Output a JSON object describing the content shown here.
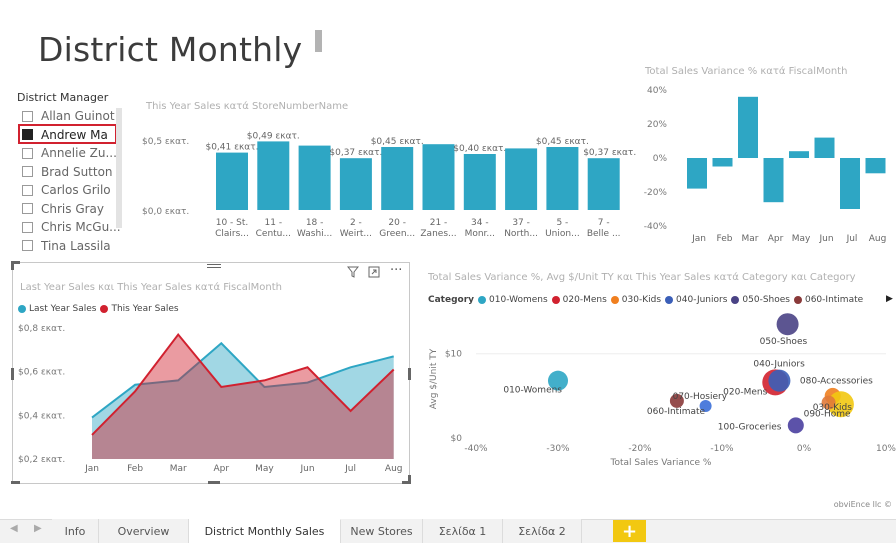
{
  "page_title": "District Monthly",
  "slicer": {
    "title": "District Manager",
    "items": [
      {
        "label": "Allan Guinot",
        "selected": false
      },
      {
        "label": "Andrew Ma",
        "selected": true
      },
      {
        "label": "Annelie Zu...",
        "selected": false
      },
      {
        "label": "Brad Sutton",
        "selected": false
      },
      {
        "label": "Carlos Grilo",
        "selected": false
      },
      {
        "label": "Chris Gray",
        "selected": false
      },
      {
        "label": "Chris McGu...",
        "selected": false
      },
      {
        "label": "Tina Lassila",
        "selected": false
      }
    ]
  },
  "bar_chart": {
    "title": "This Year Sales κατά StoreNumberName",
    "y_ticks": [
      "$0,5 εκατ.",
      "$0,0 εκατ."
    ],
    "color": "#2ea6c4"
  },
  "variance_chart": {
    "title": "Total Sales Variance % κατά FiscalMonth",
    "y_ticks": [
      "40%",
      "20%",
      "0%",
      "-20%",
      "-40%"
    ],
    "color": "#2ea6c4"
  },
  "line_chart": {
    "title": "Last Year Sales και This Year Sales κατά FiscalMonth",
    "y_ticks": [
      "$0,8 εκατ.",
      "$0,6 εκατ.",
      "$0,4 εκατ.",
      "$0,2 εκατ."
    ],
    "colors": {
      "last_year": "#2ea6c4",
      "this_year": "#d1212f"
    },
    "header_icons": [
      "filter-icon",
      "focus-mode-icon",
      "more-options-icon"
    ],
    "more_glyph": "···"
  },
  "scatter_chart": {
    "title": "Total Sales Variance %, Avg $/Unit TY και This Year Sales κατά Category και Category",
    "legend_label": "Category",
    "y_axis_label": "Avg $/Unit TY",
    "x_axis_label": "Total Sales Variance %",
    "y_ticks": [
      "$10",
      "$0"
    ],
    "x_ticks": [
      "-40%",
      "-30%",
      "-20%",
      "-10%",
      "0%",
      "10%"
    ]
  },
  "chart_data": [
    {
      "type": "bar",
      "title": "This Year Sales κατά StoreNumberName",
      "categories": [
        "10 - St. Clairs...",
        "11 - Centu...",
        "18 - Washi...",
        "2 - Weirt...",
        "20 - Green...",
        "21 - Zanes...",
        "34 - Monr...",
        "37 - North...",
        "5 - Union...",
        "7 - Belle ..."
      ],
      "category_lines": [
        [
          "10 - St.",
          "Clairs..."
        ],
        [
          "11 -",
          "Centu..."
        ],
        [
          "18 -",
          "Washi..."
        ],
        [
          "2 -",
          "Weirt..."
        ],
        [
          "20 -",
          "Green..."
        ],
        [
          "21 -",
          "Zanes..."
        ],
        [
          "34 -",
          "Monr..."
        ],
        [
          "37 -",
          "North..."
        ],
        [
          "5 -",
          "Union..."
        ],
        [
          "7 -",
          "Belle ..."
        ]
      ],
      "values": [
        0.41,
        0.49,
        0.46,
        0.37,
        0.45,
        0.47,
        0.4,
        0.44,
        0.45,
        0.37
      ],
      "data_labels": [
        "$0,41 εκατ.",
        "$0,49 εκατ.",
        "",
        "$0,37 εκατ.",
        "$0,45 εκατ.",
        "",
        "$0,40 εκατ.",
        "",
        "$0,45 εκατ.",
        "$0,37 εκατ."
      ],
      "ylim": [
        0,
        0.5
      ],
      "unit": "εκατ."
    },
    {
      "type": "bar",
      "title": "Total Sales Variance % κατά FiscalMonth",
      "categories": [
        "Jan",
        "Feb",
        "Mar",
        "Apr",
        "May",
        "Jun",
        "Jul",
        "Aug"
      ],
      "values": [
        -18,
        -5,
        36,
        -26,
        4,
        12,
        -30,
        -9
      ],
      "ylim": [
        -40,
        40
      ],
      "unit": "%"
    },
    {
      "type": "area",
      "title": "Last Year Sales και This Year Sales κατά FiscalMonth",
      "categories": [
        "Jan",
        "Feb",
        "Mar",
        "Apr",
        "May",
        "Jun",
        "Jul",
        "Aug"
      ],
      "series": [
        {
          "name": "Last Year Sales",
          "values": [
            0.39,
            0.54,
            0.56,
            0.73,
            0.53,
            0.55,
            0.62,
            0.67
          ]
        },
        {
          "name": "This Year Sales",
          "values": [
            0.31,
            0.51,
            0.77,
            0.53,
            0.56,
            0.62,
            0.42,
            0.61
          ]
        }
      ],
      "ylim": [
        0.2,
        0.8
      ],
      "unit": "εκατ."
    },
    {
      "type": "scatter",
      "title": "Total Sales Variance %, Avg $/Unit TY και This Year Sales κατά Category και Category",
      "xlabel": "Total Sales Variance %",
      "ylabel": "Avg $/Unit TY",
      "xlim": [
        -40,
        10
      ],
      "ylim": [
        0,
        14
      ],
      "legend": [
        {
          "name": "010-Womens",
          "color": "#2ea6c4"
        },
        {
          "name": "020-Mens",
          "color": "#d1212f"
        },
        {
          "name": "030-Kids",
          "color": "#f07f1f"
        },
        {
          "name": "040-Juniors",
          "color": "#3b5fb8"
        },
        {
          "name": "050-Shoes",
          "color": "#4a4385"
        },
        {
          "name": "060-Intimate",
          "color": "#8a3a3a"
        }
      ],
      "points": [
        {
          "label": "010-Womens",
          "x": -30,
          "y": 6.8,
          "color": "#2ea6c4",
          "size": 10
        },
        {
          "label": "020-Mens",
          "x": -3.5,
          "y": 6.6,
          "color": "#d1212f",
          "size": 13
        },
        {
          "label": "030-Kids",
          "x": 3.5,
          "y": 5.0,
          "color": "#f07f1f",
          "size": 8
        },
        {
          "label": "040-Juniors",
          "x": -3,
          "y": 6.8,
          "color": "#3b5fb8",
          "size": 11
        },
        {
          "label": "050-Shoes",
          "x": -2,
          "y": 13.5,
          "color": "#4a4385",
          "size": 11
        },
        {
          "label": "060-Intimate",
          "x": -15.5,
          "y": 4.4,
          "color": "#8a3a3a",
          "size": 7
        },
        {
          "label": "070-Hosiery",
          "x": -12,
          "y": 3.8,
          "color": "#3b6fd8",
          "size": 6
        },
        {
          "label": "080-Accessories",
          "x": 4.5,
          "y": 4.0,
          "color": "#f2c811",
          "size": 13
        },
        {
          "label": "090-Home",
          "x": 3,
          "y": 4.2,
          "color": "#e07a3a",
          "size": 7
        },
        {
          "label": "100-Groceries",
          "x": -1,
          "y": 1.5,
          "color": "#4a3fa0",
          "size": 8
        }
      ]
    }
  ],
  "tabs": [
    {
      "label": "Info",
      "active": false
    },
    {
      "label": "Overview",
      "active": false
    },
    {
      "label": "District Monthly Sales",
      "active": true
    },
    {
      "label": "New Stores",
      "active": false
    },
    {
      "label": "Σελίδα 1",
      "active": false
    },
    {
      "label": "Σελίδα 2",
      "active": false
    }
  ],
  "add_tab_label": "+",
  "nav": {
    "prev": "◀",
    "next": "▶",
    "legend_next": "▶"
  },
  "watermark": "obviEnce llc ©"
}
